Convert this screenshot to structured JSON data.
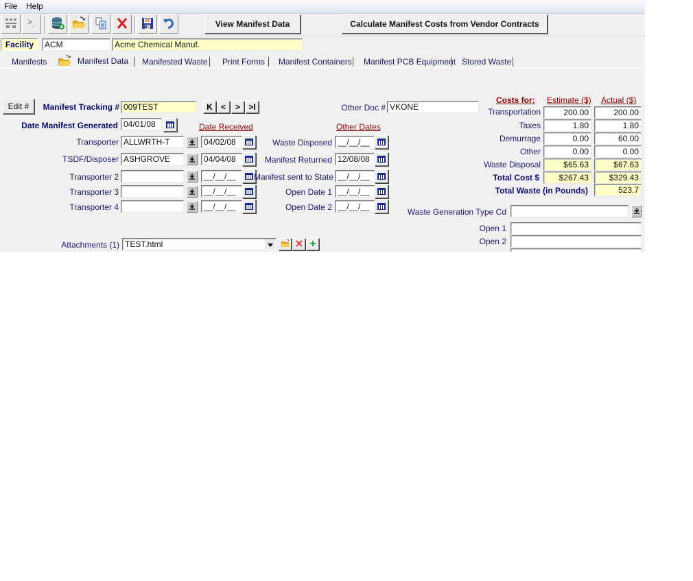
{
  "menu": {
    "items": [
      {
        "label": "File",
        "accel": "F"
      },
      {
        "label": "Help",
        "accel": "H"
      }
    ]
  },
  "toolbar": {
    "icons": [
      "network-icon",
      "command-prompt-icon",
      "database-add-icon",
      "open-folder-icon",
      "copy-icon",
      "delete-icon",
      "save-icon",
      "undo-icon"
    ],
    "view_manifest_label": "View Manifest Data",
    "calculate_label": "Calculate  Manifest Costs from Vendor Contracts"
  },
  "facility": {
    "label": "Facility",
    "code": "ACM",
    "name": "Acme Chemical Manuf."
  },
  "tabs": [
    {
      "label": "Manifests",
      "active": false
    },
    {
      "label": "Manifest Data",
      "active": true
    },
    {
      "label": "Manifested Waste",
      "active": false
    },
    {
      "label": "Print Forms",
      "active": false
    },
    {
      "label": "Manifest Containers",
      "active": false
    },
    {
      "label": "Manifest PCB Equipment",
      "active": false
    },
    {
      "label": "Stored Waste",
      "active": false
    }
  ],
  "manifest": {
    "edit_button": "Edit #",
    "tracking_label": "Manifest Tracking #",
    "tracking_value": "009TEST",
    "nav": {
      "first": "K",
      "prev": "<",
      "next": ">",
      "last": ">I"
    },
    "other_doc_label": "Other Doc #",
    "other_doc_value": "VKONE",
    "date_generated_label": "Date Manifest Generated",
    "date_generated_value": "04/01/08",
    "date_received_header": "Date Received",
    "other_dates_header": "Other Dates",
    "parties": [
      {
        "label": "Transporter",
        "value": "ALLWRTH-T",
        "date": "04/02/08"
      },
      {
        "label": "TSDF/Disposer",
        "value": "ASHGROVE",
        "date": "04/04/08"
      },
      {
        "label": "Transporter 2",
        "value": "",
        "date": "__/__/__"
      },
      {
        "label": "Transporter 3",
        "value": "",
        "date": "__/__/__"
      },
      {
        "label": "Transporter 4",
        "value": "",
        "date": "__/__/__"
      }
    ],
    "other_dates": [
      {
        "label": "Waste Disposed",
        "value": "__/__/__"
      },
      {
        "label": "Manifest Returned",
        "value": "12/08/08"
      },
      {
        "label": "Manifest sent to State",
        "value": "__/__/__"
      },
      {
        "label": "Open Date 1",
        "value": "__/__/__"
      },
      {
        "label": "Open Date 2",
        "value": "__/__/__"
      }
    ],
    "attachments_label": "Attachments (1)",
    "attachments_value": "TEST.html"
  },
  "costs": {
    "header": "Costs for:",
    "estimate_header": "Estimate ($)",
    "actual_header": "Actual ($)",
    "rows": [
      {
        "label": "Transportation",
        "estimate": "200.00",
        "actual": "200.00"
      },
      {
        "label": "Taxes",
        "estimate": "1.80",
        "actual": "1.80"
      },
      {
        "label": "Demurrage",
        "estimate": "0.00",
        "actual": "60.00"
      },
      {
        "label": "Other",
        "estimate": "0.00",
        "actual": "0.00"
      },
      {
        "label": "Waste Disposal",
        "estimate": "$65.63",
        "actual": "$67.63"
      }
    ],
    "total_cost_label": "Total Cost $",
    "total_cost_estimate": "$267.43",
    "total_cost_actual": "$329.43",
    "total_waste_label": "Total Waste (in Pounds)",
    "total_waste_value": "523.7"
  },
  "extra": {
    "waste_gen_label": "Waste Generation Type Cd",
    "waste_gen_value": "",
    "open1_label": "Open 1",
    "open1_value": "",
    "open2_label": "Open 2",
    "open2_value": ""
  }
}
